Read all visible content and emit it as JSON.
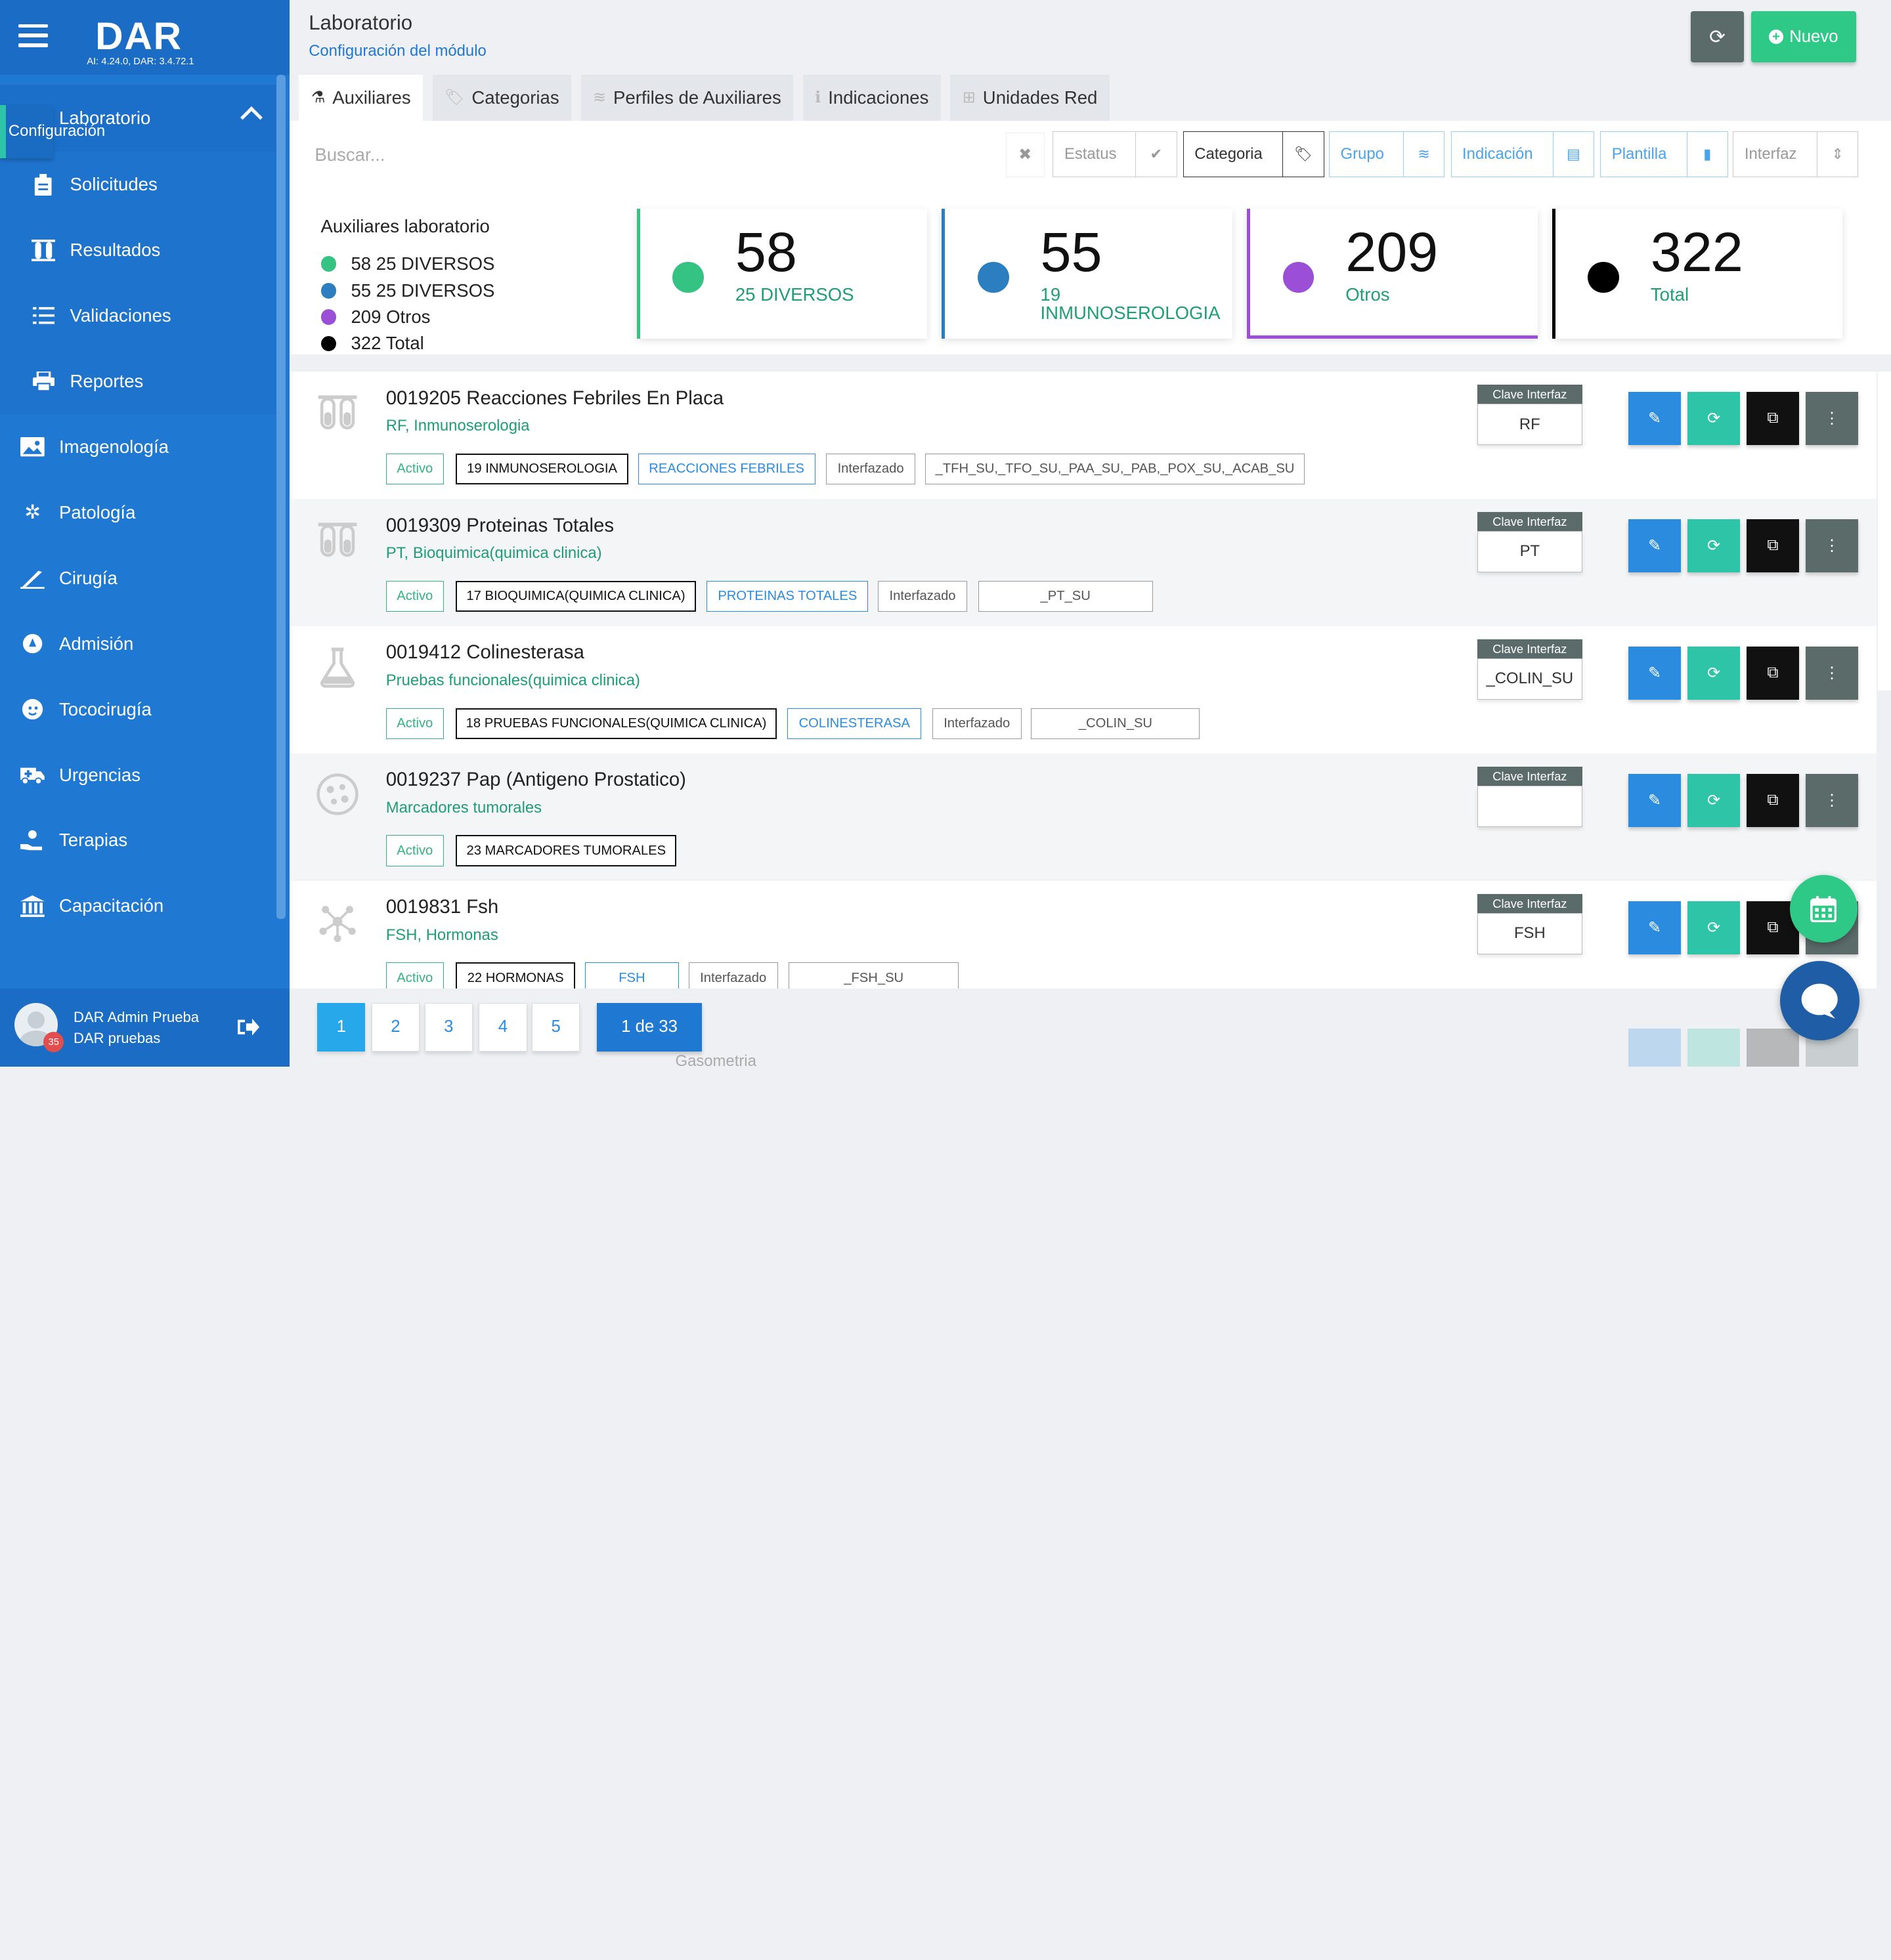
{
  "app": {
    "logo": "DAR",
    "version": "AI: 4.24.0, DAR: 3.4.72.1"
  },
  "header": {
    "title": "Laboratorio",
    "subtitle": "Configuración del módulo",
    "new_label": "Nuevo"
  },
  "sidebar": {
    "items": [
      {
        "label": "Laboratorio",
        "icon": "lab-hand-icon"
      },
      {
        "label": "Solicitudes",
        "icon": "clipboard-icon"
      },
      {
        "label": "Resultados",
        "icon": "test-tubes-icon"
      },
      {
        "label": "Validaciones",
        "icon": "checklist-icon"
      },
      {
        "label": "Reportes",
        "icon": "printer-icon"
      },
      {
        "label": "Configuración",
        "icon": "gear-icon"
      },
      {
        "label": "Imagenología",
        "icon": "image-icon"
      },
      {
        "label": "Patología",
        "icon": "virus-icon"
      },
      {
        "label": "Cirugía",
        "icon": "scalpel-icon"
      },
      {
        "label": "Admisión",
        "icon": "compass-icon"
      },
      {
        "label": "Tococirugía",
        "icon": "baby-icon"
      },
      {
        "label": "Urgencias",
        "icon": "ambulance-icon"
      },
      {
        "label": "Terapias",
        "icon": "therapy-hand-icon"
      },
      {
        "label": "Capacitación",
        "icon": "building-icon"
      }
    ]
  },
  "user": {
    "name": "DAR Admin Prueba",
    "sub": "DAR pruebas",
    "badge": "35"
  },
  "tabs": [
    {
      "label": "Auxiliares",
      "icon": "flask-icon"
    },
    {
      "label": "Categorias",
      "icon": "tags-icon"
    },
    {
      "label": "Perfiles de Auxiliares",
      "icon": "layers-icon"
    },
    {
      "label": "Indicaciones",
      "icon": "info-icon"
    },
    {
      "label": "Unidades Red",
      "icon": "sitemap-icon"
    }
  ],
  "filters": {
    "search_placeholder": "Buscar...",
    "estatus": "Estatus",
    "categoria": "Categoria",
    "grupo": "Grupo",
    "indicacion": "Indicación",
    "plantilla": "Plantilla",
    "interfaz": "Interfaz"
  },
  "stats": {
    "title": "Auxiliares laboratorio",
    "legend": [
      "58 25 DIVERSOS",
      "55 25 DIVERSOS",
      "209 Otros",
      "322 Total"
    ],
    "cards": [
      {
        "num": "58",
        "label": "25 DIVERSOS",
        "color": "#34c383"
      },
      {
        "num": "55",
        "label": "19 INMUNOSEROLOGIA",
        "color": "#2b7fc1"
      },
      {
        "num": "209",
        "label": "Otros",
        "color": "#9b4fd6"
      },
      {
        "num": "322",
        "label": "Total",
        "color": "#000000"
      }
    ]
  },
  "clave_label": "Clave Interfaz",
  "rows": [
    {
      "name": "0019205 Reacciones Febriles En Placa",
      "cat": "RF, Inmunoserologia",
      "icon": "test-tubes-icon",
      "clave": "RF",
      "tags": [
        "Activo",
        "19 INMUNOSEROLOGIA",
        "REACCIONES FEBRILES",
        "Interfazado",
        "_TFH_SU,_TFO_SU,_PAA_SU,_PAB,_POX_SU,_ACAB_SU"
      ]
    },
    {
      "name": "0019309 Proteinas Totales",
      "cat": "PT, Bioquimica(quimica clinica)",
      "icon": "test-tubes-icon",
      "clave": "PT",
      "tags": [
        "Activo",
        "17 BIOQUIMICA(QUIMICA CLINICA)",
        "PROTEINAS TOTALES",
        "Interfazado",
        "_PT_SU"
      ]
    },
    {
      "name": "0019412 Colinesterasa",
      "cat": "Pruebas funcionales(quimica clinica)",
      "icon": "flask-icon",
      "clave": "_COLIN_SU",
      "tags": [
        "Activo",
        "18 PRUEBAS FUNCIONALES(QUIMICA CLINICA)",
        "COLINESTERASA",
        "Interfazado",
        "_COLIN_SU"
      ]
    },
    {
      "name": "0019237 Pap (Antigeno Prostatico)",
      "cat": "Marcadores tumorales",
      "icon": "cells-icon",
      "clave": "",
      "tags": [
        "Activo",
        "23 MARCADORES TUMORALES"
      ]
    },
    {
      "name": "0019831 Fsh",
      "cat": "FSH, Hormonas",
      "icon": "molecule-icon",
      "clave": "FSH",
      "tags": [
        "Activo",
        "22 HORMONAS",
        "FSH",
        "Interfazado",
        "_FSH_SU"
      ]
    }
  ],
  "pagination": {
    "pages": [
      "1",
      "2",
      "3",
      "4",
      "5"
    ],
    "total": "1 de 33",
    "current": "1"
  },
  "peek": {
    "cat": "Gasometria"
  }
}
